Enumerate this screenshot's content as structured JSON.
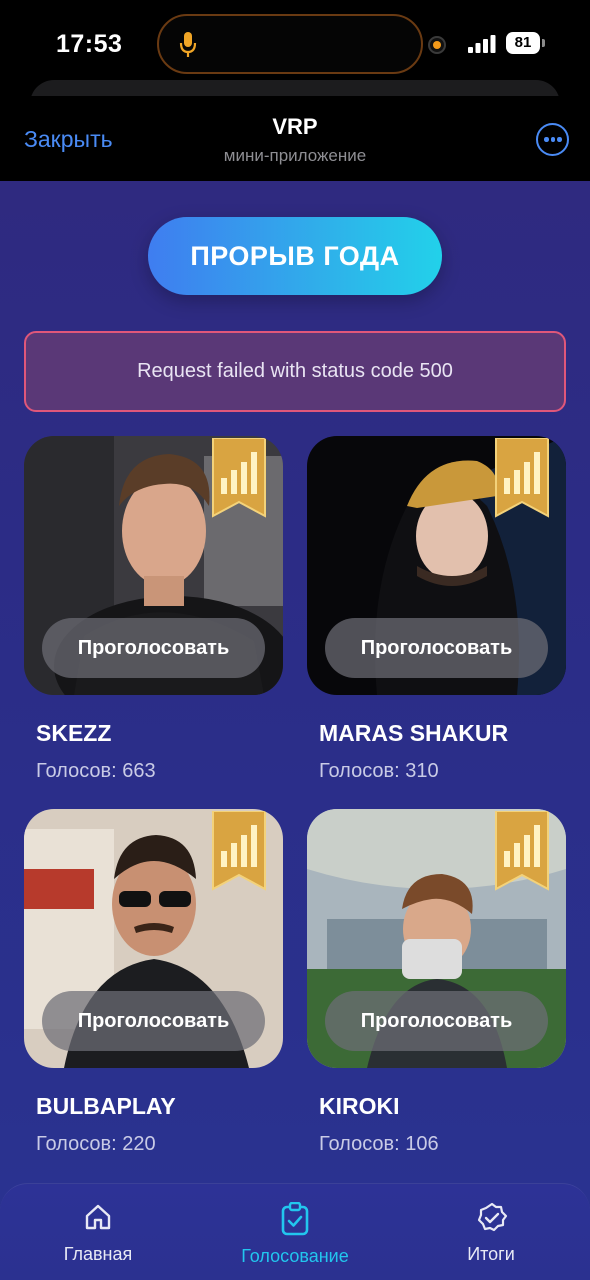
{
  "status_bar": {
    "time": "17:53",
    "battery": "81",
    "icons": [
      "mic-icon",
      "orange-dot-icon",
      "signal-icon",
      "battery-icon"
    ]
  },
  "header": {
    "close_label": "Закрыть",
    "title": "VRP",
    "subtitle": "мини-приложение",
    "more_icon": "more-icon"
  },
  "main": {
    "title": "ПРОРЫВ ГОДА",
    "error": "Request failed with status code 500",
    "candidates": [
      {
        "name": "SKEZZ",
        "votes": "Голосов: 663",
        "vote_label": "Проголосовать"
      },
      {
        "name": "MARAS SHAKUR",
        "votes": "Голосов: 310",
        "vote_label": "Проголосовать"
      },
      {
        "name": "BULBAPLAY",
        "votes": "Голосов: 220",
        "vote_label": "Проголосовать"
      },
      {
        "name": "KIROKI",
        "votes": "Голосов: 106",
        "vote_label": "Проголосовать"
      }
    ]
  },
  "nav": {
    "items": [
      {
        "label": "Главная",
        "icon": "home-icon"
      },
      {
        "label": "Голосование",
        "icon": "clipboard-check-icon",
        "active": true
      },
      {
        "label": "Итоги",
        "icon": "check-badge-icon"
      }
    ]
  },
  "colors": {
    "accent": "#4a8bf5",
    "active_nav": "#22c6ee",
    "error_border": "#e0577a",
    "app_bg": "#2b2d88"
  }
}
